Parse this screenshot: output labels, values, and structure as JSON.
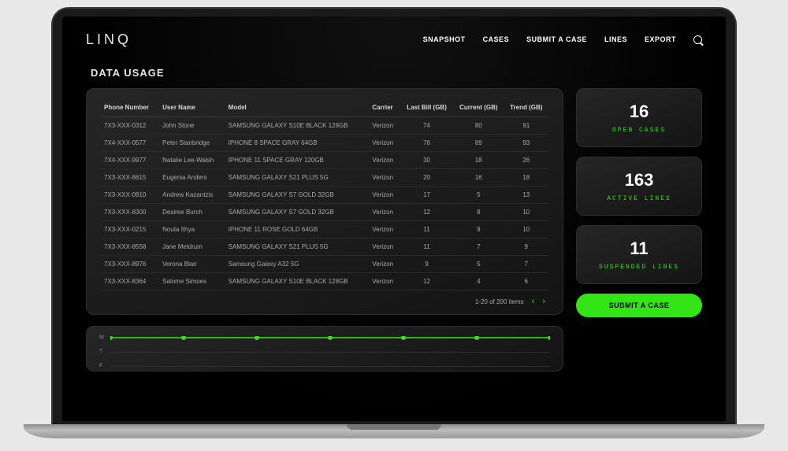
{
  "brand": "LINQ",
  "nav": {
    "items": [
      "SNAPSHOT",
      "CASES",
      "SUBMIT A CASE",
      "LINES",
      "EXPORT"
    ]
  },
  "page_title": "DATA USAGE",
  "columns": [
    "Phone Number",
    "User Name",
    "Model",
    "Carrier",
    "Last Bill (GB)",
    "Current (GB)",
    "Trend (GB)"
  ],
  "rows": [
    {
      "phone": "7X3-XXX-0312",
      "user": "John Stone",
      "model": "SAMSUNG GALAXY S10E BLACK 128GB",
      "carrier": "Verizon",
      "last": "74",
      "curr": "80",
      "trend": "91"
    },
    {
      "phone": "7X4-XXX-0577",
      "user": "Peter Stanbridge",
      "model": "IPHONE 8 SPACE GRAY 64GB",
      "carrier": "Verizon",
      "last": "76",
      "curr": "89",
      "trend": "93"
    },
    {
      "phone": "7X4-XXX-9977",
      "user": "Natalie Lee-Walsh",
      "model": "IPHONE 11 SPACE GRAY 120GB",
      "carrier": "Verizon",
      "last": "30",
      "curr": "18",
      "trend": "26"
    },
    {
      "phone": "7X3-XXX-8615",
      "user": "Eugenia Anders",
      "model": "SAMSUNG GALAXY S21 PLUS 5G",
      "carrier": "Verizon",
      "last": "20",
      "curr": "16",
      "trend": "18"
    },
    {
      "phone": "7X3-XXX-0910",
      "user": "Andrew Kazantzis",
      "model": "SAMSUNG GALAXY S7 GOLD 32GB",
      "carrier": "Verizon",
      "last": "17",
      "curr": "5",
      "trend": "13"
    },
    {
      "phone": "7X3-XXX-8300",
      "user": "Desiree Burch",
      "model": "SAMSUNG GALAXY S7 GOLD 32GB",
      "carrier": "Verizon",
      "last": "12",
      "curr": "8",
      "trend": "10"
    },
    {
      "phone": "7X3-XXX-0215",
      "user": "Nouta Ithya",
      "model": "IPHONE 11 ROSE GOLD 64GB",
      "carrier": "Verizon",
      "last": "11",
      "curr": "9",
      "trend": "10"
    },
    {
      "phone": "7X3-XXX-8558",
      "user": "Jane Meldrum",
      "model": "SAMSUNG GALAXY S21 PLUS 5G",
      "carrier": "Verizon",
      "last": "11",
      "curr": "7",
      "trend": "9"
    },
    {
      "phone": "7X3-XXX-8976",
      "user": "Verona Blair",
      "model": "Samsung Galaxy A32 5G",
      "carrier": "Verizon",
      "last": "9",
      "curr": "5",
      "trend": "7"
    },
    {
      "phone": "7X3-XXX-8364",
      "user": "Salome Simoes",
      "model": "SAMSUNG GALAXY S10E BLACK 128GB",
      "carrier": "Verizon",
      "last": "12",
      "curr": "4",
      "trend": "6"
    }
  ],
  "pager": {
    "text": "1-20 of 200 items"
  },
  "stats": [
    {
      "value": "16",
      "label": "OPEN CASES"
    },
    {
      "value": "163",
      "label": "ACTIVE LINES"
    },
    {
      "value": "11",
      "label": "SUSPENDED LINES"
    }
  ],
  "cta_label": "SUBMIT A CASE",
  "chart_data": {
    "type": "line",
    "y_ticks": [
      "M",
      "T",
      "F"
    ],
    "x": [
      0,
      1,
      2,
      3,
      4,
      5,
      6
    ],
    "values": [
      1,
      1,
      1,
      1,
      1,
      1,
      1
    ],
    "title": "",
    "xlabel": "",
    "ylabel": ""
  },
  "colors": {
    "accent": "#34e515"
  }
}
